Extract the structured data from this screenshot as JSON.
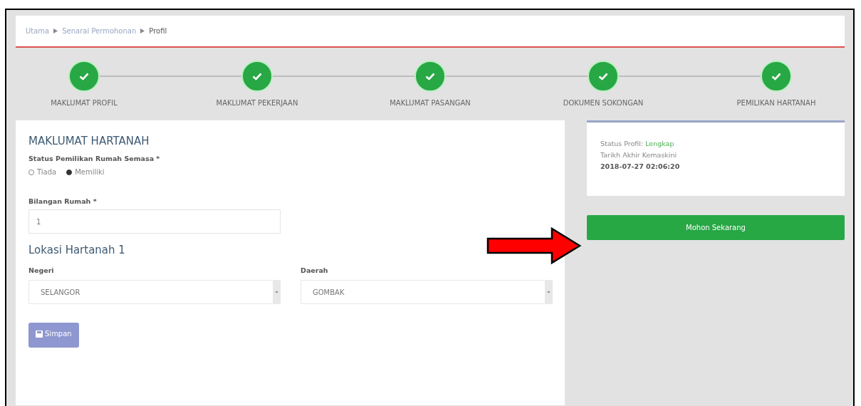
{
  "breadcrumb": [
    {
      "label": "Utama"
    },
    {
      "label": "Senarai Permohonan"
    },
    {
      "label": "Profil"
    }
  ],
  "steps": [
    {
      "label": "MAKLUMAT PROFIL",
      "completed": true
    },
    {
      "label": "MAKLUMAT PEKERJAAN",
      "completed": true
    },
    {
      "label": "MAKLUMAT PASANGAN",
      "completed": true
    },
    {
      "label": "DOKUMEN SOKONGAN",
      "completed": true
    },
    {
      "label": "PEMILIKAN HARTANAH",
      "completed": true
    }
  ],
  "form": {
    "title": "MAKLUMAT HARTANAH",
    "status_label": "Status Pemilikan Rumah Semasa *",
    "status_options": [
      {
        "label": "Tiada",
        "selected": false
      },
      {
        "label": "Memiliki",
        "selected": true
      }
    ],
    "count_label": "Bilangan Rumah *",
    "count_value": "1",
    "location_title": "Lokasi Hartanah 1",
    "negeri": {
      "label": "Negeri",
      "value": "SELANGOR"
    },
    "daerah": {
      "label": "Daerah",
      "value": "GOMBAK"
    },
    "save_button": "Simpan"
  },
  "summary": {
    "status_label": "Status Profil:",
    "status_value": "Lengkap",
    "date_label": "Tarikh Akhir Kemaskini",
    "date_value": "2018-07-27 02:06:20"
  },
  "apply_button": "Mohon Sekarang"
}
